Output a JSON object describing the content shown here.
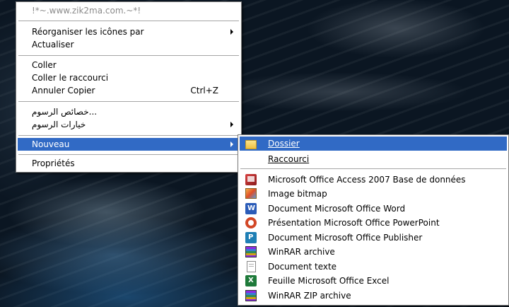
{
  "context_menu": {
    "header": "!*~.www.zik2ma.com.~*!",
    "items": [
      {
        "label": "Réorganiser les icônes par",
        "submenu": true
      },
      {
        "label": "Actualiser"
      },
      {
        "label": "Coller"
      },
      {
        "label": "Coller le raccourci"
      },
      {
        "label": "Annuler Copier",
        "shortcut": "Ctrl+Z"
      },
      {
        "label": "...خصائص الرسوم"
      },
      {
        "label": "خيارات الرسوم",
        "submenu": true
      },
      {
        "label": "Nouveau",
        "submenu": true,
        "highlighted": true
      },
      {
        "label": "Propriétés"
      }
    ]
  },
  "submenu": {
    "items": [
      {
        "label": "Dossier",
        "icon": "folder-icon",
        "highlighted": true
      },
      {
        "label": "Raccourci",
        "icon": "shortcut-icon"
      },
      {
        "label": "Microsoft Office Access 2007 Base de données",
        "icon": "access-icon"
      },
      {
        "label": "Image bitmap",
        "icon": "bitmap-icon"
      },
      {
        "label": "Document Microsoft Office Word",
        "icon": "word-icon"
      },
      {
        "label": "Présentation Microsoft Office PowerPoint",
        "icon": "powerpoint-icon"
      },
      {
        "label": "Document Microsoft Office Publisher",
        "icon": "publisher-icon"
      },
      {
        "label": "WinRAR archive",
        "icon": "winrar-icon"
      },
      {
        "label": "Document texte",
        "icon": "text-document-icon"
      },
      {
        "label": "Feuille Microsoft Office Excel",
        "icon": "excel-icon"
      },
      {
        "label": "WinRAR ZIP archive",
        "icon": "winrar-zip-icon"
      }
    ]
  },
  "colors": {
    "highlight": "#316ac5",
    "menu_background": "#ffffff",
    "disabled_text": "#8a8a8a"
  }
}
